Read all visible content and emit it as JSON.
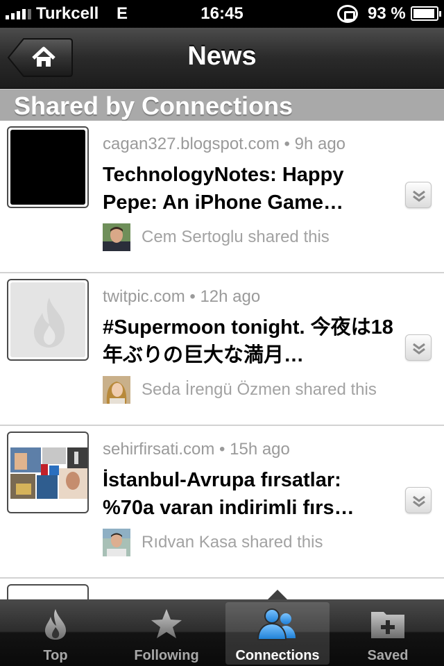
{
  "status_bar": {
    "carrier": "Turkcell",
    "network": "E",
    "time": "16:45",
    "battery_percent": "93 %",
    "battery_level": 0.93,
    "icons": [
      "signal-icon",
      "rotation-lock-icon",
      "battery-icon"
    ]
  },
  "navbar": {
    "title": "News",
    "back_icon": "home-icon"
  },
  "section": {
    "title": "Shared by Connections"
  },
  "feed": [
    {
      "source": "cagan327.blogspot.com",
      "age": "9h ago",
      "separator": "•",
      "title": "TechnologyNotes: Happy Pepe: An iPhone Game…",
      "sharer": "Cem Sertoglu shared this",
      "thumbnail": "black-image"
    },
    {
      "source": "twitpic.com",
      "age": "12h ago",
      "separator": "•",
      "title": "#Supermoon tonight. 今夜は18年ぶりの巨大な満月…",
      "sharer": "Seda İrengü Özmen shared this",
      "thumbnail": "flame-placeholder"
    },
    {
      "source": "sehirfirsati.com",
      "age": "15h ago",
      "separator": "•",
      "title": "İstanbul-Avrupa fırsatlar: %70a varan indirimli fırs…",
      "sharer": "Rıdvan Kasa shared this",
      "thumbnail": "collage-image"
    }
  ],
  "tabs": [
    {
      "label": "Top",
      "icon": "flame-icon",
      "active": false
    },
    {
      "label": "Following",
      "icon": "star-icon",
      "active": false
    },
    {
      "label": "Connections",
      "icon": "people-icon",
      "active": true
    },
    {
      "label": "Saved",
      "icon": "folder-add-icon",
      "active": false
    }
  ],
  "colors": {
    "section_header_bg": "#a9a9a9",
    "meta_text": "#9a9a9a",
    "active_tab_icon": "#3a9be6"
  }
}
